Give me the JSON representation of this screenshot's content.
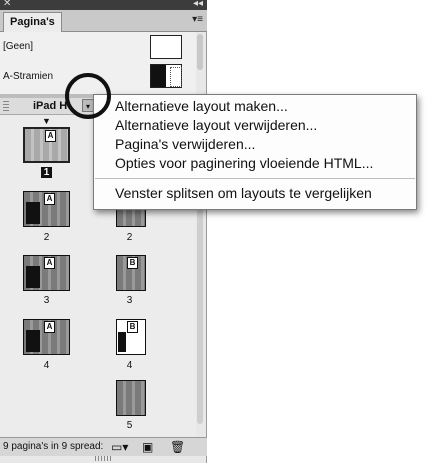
{
  "panel": {
    "close_glyph": "✕",
    "collapse_glyph": "◂◂",
    "tab_label": "Pagina's",
    "tab_menu_glyph": "▾≡",
    "masters": [
      {
        "label": "[Geen]"
      },
      {
        "label": "A-Stramien"
      }
    ],
    "layout_name": "iPad H",
    "layout_dropdown_glyph": "▾",
    "pages": [
      {
        "number": "1",
        "badge": "A",
        "selected": true
      },
      {
        "number": "2",
        "badge": "A"
      },
      {
        "number": "2",
        "badge": "B"
      },
      {
        "number": "3",
        "badge": "A"
      },
      {
        "number": "3",
        "badge": "B"
      },
      {
        "number": "4",
        "badge": "A"
      },
      {
        "number": "4",
        "badge": "B"
      },
      {
        "number": "5",
        "badge": ""
      }
    ],
    "footer_text": "9 pagina's in 9 spread:",
    "footer_icons": [
      "page-size-icon",
      "new-page-icon",
      "trash-icon"
    ]
  },
  "menu": {
    "items": [
      "Alternatieve layout maken...",
      "Alternatieve layout verwijderen...",
      "Pagina's verwijderen...",
      "Opties voor paginering vloeiende HTML...",
      "Venster splitsen om layouts te vergelijken"
    ]
  },
  "colors": {
    "highlight_circle": "#111111",
    "panel_bg": "#e8e8e8"
  }
}
